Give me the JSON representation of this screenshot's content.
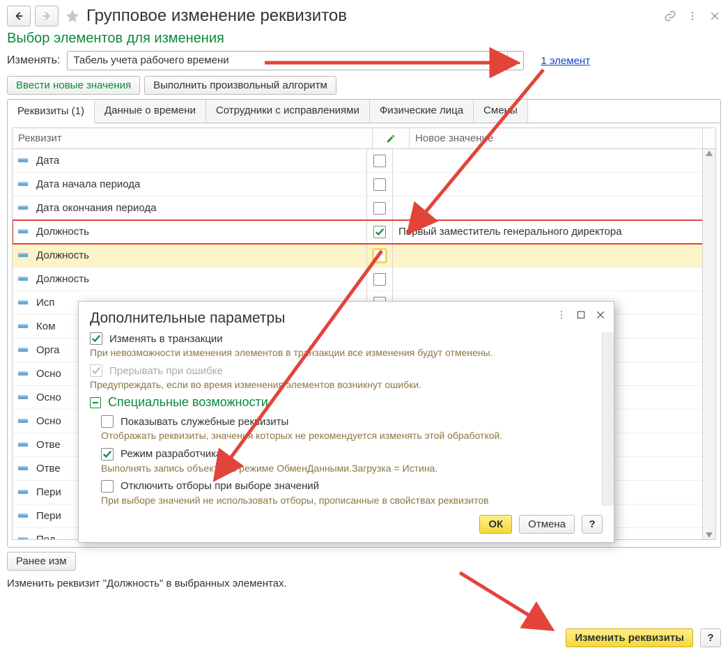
{
  "window": {
    "title": "Групповое изменение реквизитов",
    "section": "Выбор элементов для изменения",
    "change_label": "Изменять:",
    "change_value": "Табель учета рабочего времени",
    "change_dd": "…",
    "link_one": "1 элемент"
  },
  "buttons": {
    "enter_new": "Ввести новые значения",
    "algo": "Выполнить произвольный алгоритм",
    "prev": "Ранее изм",
    "change": "Изменить реквизиты",
    "help": "?"
  },
  "tabs": {
    "t1": "Реквизиты (1)",
    "t2": "Данные о времени",
    "t3": "Сотрудники с исправлениями",
    "t4": "Физические лица",
    "t5": "Смены"
  },
  "table": {
    "col1": "Реквизит",
    "col3": "Новое значение",
    "rows": [
      {
        "label": "Дата",
        "checked": false,
        "value": ""
      },
      {
        "label": "Дата начала периода",
        "checked": false,
        "value": ""
      },
      {
        "label": "Дата окончания периода",
        "checked": false,
        "value": ""
      },
      {
        "label": "Должность",
        "checked": true,
        "value": "Первый заместитель генерального директора",
        "hi": true
      },
      {
        "label": "Должность",
        "checked": false,
        "value": "",
        "sel": true
      },
      {
        "label": "Должность",
        "checked": false,
        "value": ""
      },
      {
        "label": "Исп",
        "checked": false,
        "value": ""
      },
      {
        "label": "Ком",
        "checked": false,
        "value": ""
      },
      {
        "label": "Орга",
        "checked": false,
        "value": ""
      },
      {
        "label": "Осно",
        "checked": false,
        "value": ""
      },
      {
        "label": "Осно",
        "checked": false,
        "value": ""
      },
      {
        "label": "Осно",
        "checked": false,
        "value": ""
      },
      {
        "label": "Отве",
        "checked": false,
        "value": ""
      },
      {
        "label": "Отве",
        "checked": false,
        "value": ""
      },
      {
        "label": "Пери",
        "checked": false,
        "value": ""
      },
      {
        "label": "Пери",
        "checked": false,
        "value": ""
      },
      {
        "label": "Под",
        "checked": false,
        "value": ""
      }
    ]
  },
  "summary": "Изменить реквизит \"Должность\" в выбранных элементах.",
  "dialog": {
    "title": "Дополнительные параметры",
    "cb1": "Изменять в транзакции",
    "note1": "При невозможности изменения элементов в транзакции все изменения будут отменены.",
    "cb2": "Прерывать при ошибке",
    "note2": "Предупреждать, если во время изменения элементов возникнут ошибки.",
    "section": "Специальные возможности",
    "cb3": "Показывать служебные реквизиты",
    "note3": "Отображать реквизиты, значения которых не рекомендуется изменять этой обработкой.",
    "cb4": "Режим разработчика",
    "note4": "Выполнять запись объектов в режиме ОбменДанными.Загрузка = Истина.",
    "cb5": "Отключить отборы при выборе значений",
    "note5": "При выборе значений не использовать отборы, прописанные в свойствах реквизитов",
    "ok": "ОК",
    "cancel": "Отмена",
    "help": "?"
  }
}
